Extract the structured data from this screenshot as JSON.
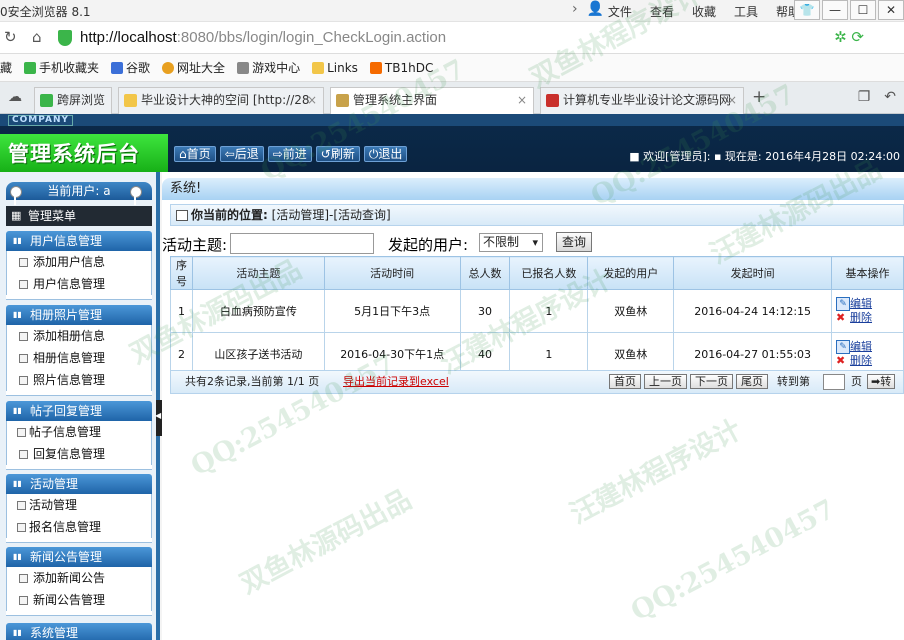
{
  "browser": {
    "title": "0安全浏览器 8.1",
    "menus": [
      "文件",
      "查看",
      "收藏",
      "工具",
      "帮助"
    ],
    "url_host": "http://localhost",
    "url_rest": ":8080/bbs/login/login_CheckLogin.action",
    "bookmarks": [
      "藏",
      "手机收藏夹",
      "谷歌",
      "网址大全",
      "游戏中心",
      "Links",
      "TB1hDC"
    ],
    "tabs": [
      "跨屏浏览",
      "毕业设计大神的空间 [http://28",
      "管理系统主界面",
      "计算机专业毕业设计论文源码网"
    ]
  },
  "header": {
    "company": "COMPANY",
    "brand": "管理系统后台",
    "nav": [
      "首页",
      "后退",
      "前进",
      "刷新",
      "退出"
    ],
    "status": "■ 欢迎[管理员]: ▪ 现在是: 2016年4月28日 02:24:00"
  },
  "sidebar": {
    "current_user": "当前用户: a",
    "menu_title": "管理菜单",
    "groups": [
      {
        "title": "用户信息管理",
        "items": [
          "添加用户信息",
          "用户信息管理"
        ]
      },
      {
        "title": "相册照片管理",
        "items": [
          "添加相册信息",
          "相册信息管理",
          "照片信息管理"
        ]
      },
      {
        "title": "帖子回复管理",
        "items": [
          "帖子信息管理",
          "回复信息管理"
        ]
      },
      {
        "title": "活动管理",
        "items": [
          "活动管理",
          "报名信息管理"
        ]
      },
      {
        "title": "新闻公告管理",
        "items": [
          "添加新闻公告",
          "新闻公告管理"
        ]
      },
      {
        "title": "系统管理",
        "items": []
      }
    ]
  },
  "main": {
    "system_label": "系统!",
    "position_label": "你当前的位置:",
    "position_value": "[活动管理]-[活动查询]",
    "search": {
      "topic_label": "活动主题:",
      "topic_value": "",
      "user_label": "发起的用户:",
      "user_select": "不限制",
      "query_button": "查询"
    },
    "table": {
      "headers": [
        "序号",
        "活动主题",
        "活动时间",
        "总人数",
        "已报名人数",
        "发起的用户",
        "发起时间",
        "基本操作"
      ],
      "rows": [
        [
          "1",
          "白血病预防宣传",
          "5月1日下午3点",
          "30",
          "1",
          "双鱼林",
          "2016-04-24 14:12:15"
        ],
        [
          "2",
          "山区孩子送书活动",
          "2016-04-30下午1点",
          "40",
          "1",
          "双鱼林",
          "2016-04-27 01:55:03"
        ]
      ],
      "edit_label": "编辑",
      "delete_label": "删除"
    },
    "pager": {
      "info": "共有2条记录,当前第 1/1 页",
      "export": "导出当前记录到excel",
      "buttons": [
        "首页",
        "上一页",
        "下一页",
        "尾页"
      ],
      "goto_label": "转到第",
      "page_unit": "页",
      "go_button": "➡转"
    }
  },
  "watermarks": [
    "QQ:254540457",
    "双鱼林程序设计",
    "汪建林源码出品",
    "QQ:254540457",
    "双鱼林源码出品",
    "汪建林程序设计",
    "QQ:254540457",
    "双鱼林源码出品",
    "汪建林程序设计",
    "QQ:254540457"
  ]
}
